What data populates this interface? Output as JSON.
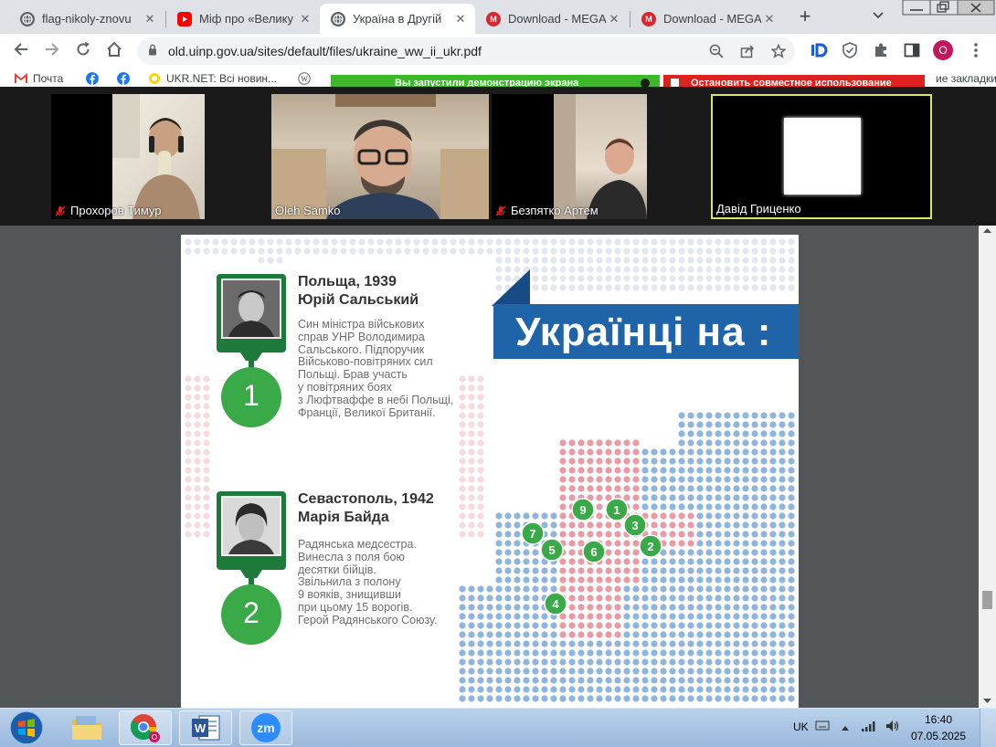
{
  "browser": {
    "tabs": [
      {
        "title": "flag-nikoly-znovu",
        "icon": "globe-icon",
        "active": false
      },
      {
        "title": "Міф про «Велику",
        "icon": "youtube-icon",
        "active": false
      },
      {
        "title": "Україна в Другій",
        "icon": "globe-icon",
        "active": true
      },
      {
        "title": "Download - MEGA",
        "icon": "mega-icon",
        "active": false
      },
      {
        "title": "Download - MEGA",
        "icon": "mega-icon",
        "active": false
      }
    ],
    "url": "old.uinp.gov.ua/sites/default/files/ukraine_ww_ii_ukr.pdf",
    "profile_initial": "O",
    "bookmarks": [
      {
        "label": "Почта",
        "icon": "gmail-icon"
      },
      {
        "label": "",
        "icon": "facebook-icon"
      },
      {
        "label": "",
        "icon": "facebook-icon"
      },
      {
        "label": "UKR.NET: Всі новин...",
        "icon": "ukrnet-icon"
      },
      {
        "label": "",
        "icon": "wikipedia-icon"
      }
    ],
    "bookmarks_tail": "ие закладки",
    "share_banner_text": "Вы запустили демонстрацию экрана",
    "stop_share_text": "Остановить совместное использование"
  },
  "zoom": {
    "participants": [
      {
        "name": "Прохоров Тимур",
        "muted": true
      },
      {
        "name": "Oleh  Samko",
        "muted": false
      },
      {
        "name": "Безпятко Артем",
        "muted": true
      },
      {
        "name": "Давід Гриценко",
        "muted": false
      }
    ]
  },
  "pdf": {
    "banner_title": "Українці на :",
    "entries": [
      {
        "number": "1",
        "heading_line1": "Польща, 1939",
        "heading_line2": "Юрій Сальський",
        "description": [
          "Син міністра військових",
          "справ  УНР Володимира",
          "Сальського. Підпоручик",
          "Військово-повітряних сил",
          "Польщі. Брав участь",
          "у повітряних боях",
          "з Люфтваффе в небі Польщі,",
          "Франції, Великої Британії."
        ]
      },
      {
        "number": "2",
        "heading_line1": "Севастополь, 1942",
        "heading_line2": "Марія Байда",
        "description": [
          "Радянська медсестра.",
          "Винесла з поля бою",
          "десятки бійців.",
          "Звільнила з полону",
          "9 вояків, знищивши",
          "при цьому 15 ворогів.",
          "Герой Радянського Союзу."
        ]
      }
    ],
    "map_markers": [
      "9",
      "1",
      "3",
      "7",
      "2",
      "5",
      "6",
      "4"
    ],
    "colors": {
      "green": "#3aaa48",
      "dark_green": "#1e7a3a",
      "blue": "#1f63a8",
      "dot_blue": "#8fb4dd",
      "dot_red": "#e99aa5",
      "dot_grey": "#e3e6ee"
    }
  },
  "taskbar": {
    "apps": [
      "windows-start-icon",
      "file-explorer-icon",
      "chrome-icon",
      "word-icon",
      "zoom-icon"
    ],
    "language": "UK",
    "time": "16:40",
    "date": "07.05.2025"
  }
}
